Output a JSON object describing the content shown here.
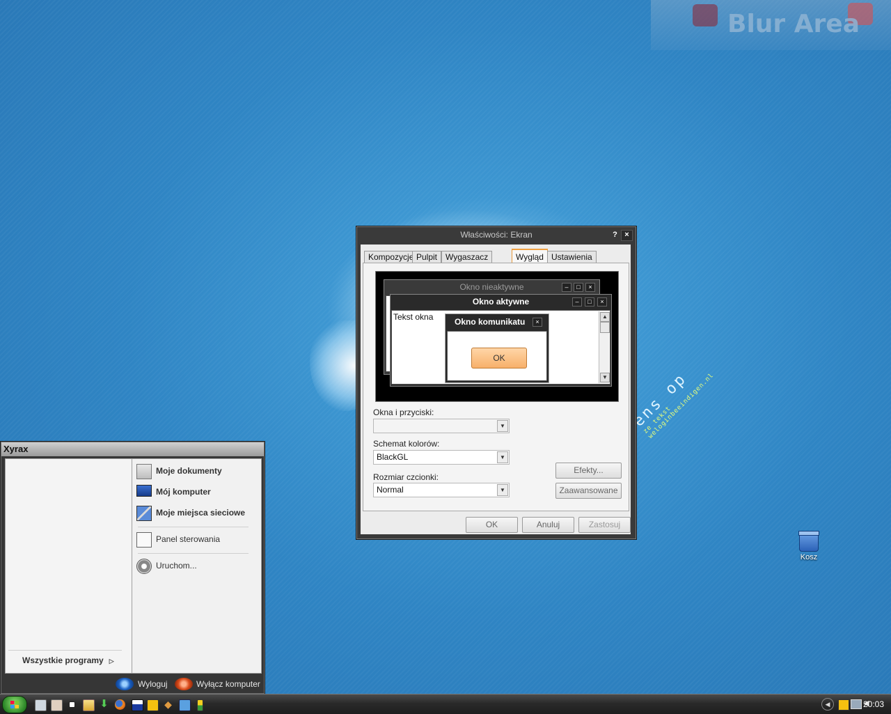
{
  "desktop": {
    "blur_area_label": "Blur Area",
    "watermark_line1": "ens op",
    "watermark_line2": "ze tekst",
    "watermark_line3": "weloginbeeindigen.nl",
    "icons": [
      {
        "label": "Kosz",
        "icon": "recycle-bin-icon"
      }
    ]
  },
  "dialog": {
    "title": "Właściwości: Ekran",
    "help_label": "?",
    "close_label": "×",
    "tabs": [
      {
        "label": "Kompozycje",
        "active": false
      },
      {
        "label": "Pulpit",
        "active": false
      },
      {
        "label": "Wygaszacz ekranu",
        "active": false
      },
      {
        "label": "Wygląd",
        "active": true
      },
      {
        "label": "Ustawienia",
        "active": false
      }
    ],
    "preview": {
      "inactive_title": "Okno nieaktywne",
      "active_title": "Okno aktywne",
      "window_text": "Tekst okna",
      "message_title": "Okno komunikatu",
      "ok_label": "OK"
    },
    "windows_buttons_label": "Okna i przyciski:",
    "windows_buttons_value": "",
    "color_scheme_label": "Schemat kolorów:",
    "color_scheme_value": "BlackGL",
    "font_size_label": "Rozmiar czcionki:",
    "font_size_value": "Normal",
    "effects_button": "Efekty...",
    "advanced_button": "Zaawansowane",
    "ok_button": "OK",
    "cancel_button": "Anuluj",
    "apply_button": "Zastosuj"
  },
  "start_menu": {
    "user": "Xyrax",
    "right_items": [
      {
        "label": "Moje dokumenty",
        "icon": "documents-icon",
        "bold": true
      },
      {
        "label": "Mój komputer",
        "icon": "computer-icon",
        "bold": true
      },
      {
        "label": "Moje miejsca sieciowe",
        "icon": "network-icon",
        "bold": true
      },
      {
        "label": "Panel sterowania",
        "icon": "control-panel-icon",
        "bold": false
      },
      {
        "label": "Uruchom...",
        "icon": "run-icon",
        "bold": false
      }
    ],
    "all_programs": "Wszystkie programy",
    "logoff": "Wyloguj",
    "shutdown": "Wyłącz komputer"
  },
  "taskbar": {
    "clock": "20:03",
    "quick_launch": [
      "show-desktop-icon",
      "explorer-icon",
      "cmd-icon",
      "folder-icon",
      "download-icon",
      "firefox-icon",
      "floppy-icon",
      "media-player-icon",
      "tools-icon",
      "notepad-icon",
      "battery-icon"
    ]
  },
  "colors": {
    "desktop_blue": "#2f85c4",
    "window_frame": "#3a3a3a",
    "tab_accent": "#f0a040",
    "ok_button_orange": "#f7b06a"
  }
}
